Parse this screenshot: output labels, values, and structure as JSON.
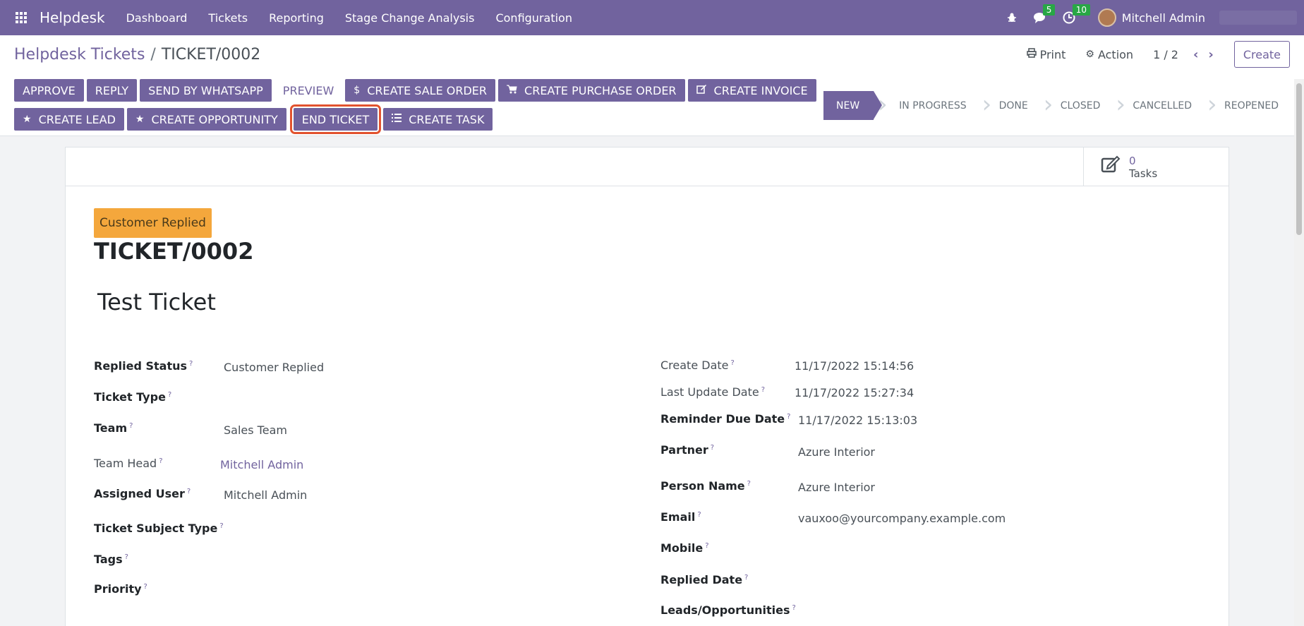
{
  "navbar": {
    "brand": "Helpdesk",
    "menu": [
      "Dashboard",
      "Tickets",
      "Reporting",
      "Stage Change Analysis",
      "Configuration"
    ],
    "messages_count": "5",
    "activities_count": "10",
    "user": "Mitchell Admin"
  },
  "breadcrumb": {
    "parent": "Helpdesk Tickets",
    "separator": "/",
    "current": "TICKET/0002"
  },
  "toolbar": {
    "print": "Print",
    "action": "Action",
    "pager": "1 / 2",
    "create": "Create"
  },
  "buttons_row1": [
    "APPROVE",
    "REPLY",
    "SEND BY WHATSAPP",
    "PREVIEW",
    "CREATE SALE ORDER",
    "CREATE PURCHASE ORDER",
    "CREATE INVOICE"
  ],
  "buttons_row2": [
    "CREATE LEAD",
    "CREATE OPPORTUNITY",
    "END TICKET",
    "CREATE TASK"
  ],
  "stages": [
    "NEW",
    "IN PROGRESS",
    "DONE",
    "CLOSED",
    "CANCELLED",
    "REOPENED"
  ],
  "smart_button": {
    "value": "0",
    "label": "Tasks"
  },
  "ribbon": "Customer Replied",
  "ticket_code": "TICKET/0002",
  "ticket_name": "Test Ticket",
  "help_mark": "?",
  "left_fields": [
    {
      "label": "Replied Status",
      "value": "Customer Replied"
    },
    {
      "label": "Ticket Type",
      "value": ""
    },
    {
      "label": "Team",
      "value": "Sales Team"
    },
    {
      "label": "Team Head",
      "value": "Mitchell Admin"
    },
    {
      "label": "Assigned User",
      "value": "Mitchell Admin"
    },
    {
      "label": "Ticket Subject Type",
      "value": ""
    },
    {
      "label": "Tags",
      "value": ""
    },
    {
      "label": "Priority",
      "value": ""
    }
  ],
  "right_fields": [
    {
      "label": "Create Date",
      "value": "11/17/2022 15:14:56"
    },
    {
      "label": "Last Update Date",
      "value": "11/17/2022 15:27:34"
    },
    {
      "label": "Reminder Due Date",
      "value": "11/17/2022 15:13:03"
    },
    {
      "label": "Partner",
      "value": "Azure Interior"
    },
    {
      "label": "Person Name",
      "value": "Azure Interior"
    },
    {
      "label": "Email",
      "value": "vauxoo@yourcompany.example.com"
    },
    {
      "label": "Mobile",
      "value": ""
    },
    {
      "label": "Replied Date",
      "value": ""
    },
    {
      "label": "Leads/Opportunities",
      "value": ""
    }
  ],
  "colors": {
    "primary": "#71639e",
    "ribbon": "#f4a73c",
    "highlight": "#e2532f"
  }
}
